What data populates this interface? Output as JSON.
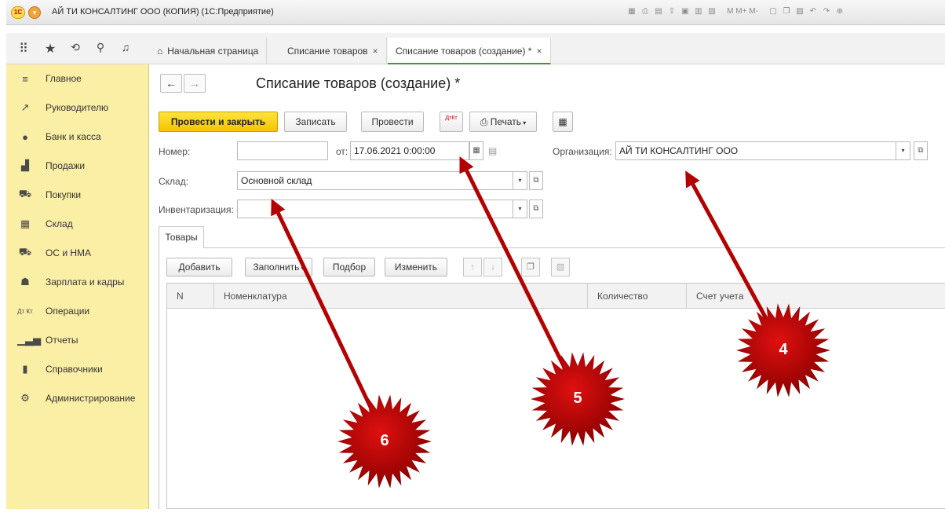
{
  "window": {
    "title": "АЙ ТИ КОНСАЛТИНГ ООО (КОПИЯ)  (1С:Предприятие)",
    "logo_text": "1С",
    "toolbar_text": "M  M+  M-"
  },
  "tabs": [
    {
      "label": "Начальная страница"
    },
    {
      "label": "Списание товаров",
      "close": "×"
    },
    {
      "label": "Списание товаров (создание) *",
      "close": "×"
    }
  ],
  "sidebar": {
    "items": [
      {
        "label": "Главное",
        "icon": "menu-lines-icon"
      },
      {
        "label": "Руководителю",
        "icon": "trend-icon"
      },
      {
        "label": "Банк и касса",
        "icon": "ruble-coin-icon"
      },
      {
        "label": "Продажи",
        "icon": "shopping-bag-icon"
      },
      {
        "label": "Покупки",
        "icon": "cart-icon"
      },
      {
        "label": "Склад",
        "icon": "warehouse-grid-icon"
      },
      {
        "label": "ОС и НМА",
        "icon": "truck-icon"
      },
      {
        "label": "Зарплата и кадры",
        "icon": "person-icon"
      },
      {
        "label": "Операции",
        "icon": "dt-kt-icon"
      },
      {
        "label": "Отчеты",
        "icon": "bar-chart-icon"
      },
      {
        "label": "Справочники",
        "icon": "books-icon"
      },
      {
        "label": "Администрирование",
        "icon": "gear-icon"
      }
    ]
  },
  "document": {
    "title": "Списание товаров (создание) *",
    "buttons": {
      "post_close": "Провести и закрыть",
      "save": "Записать",
      "post": "Провести",
      "print": "Печать",
      "dtkt": "ДтКт"
    },
    "fields": {
      "number_label": "Номер:",
      "number_value": "",
      "date_label": "от:",
      "date_value": "17.06.2021  0:00:00",
      "org_label": "Организация:",
      "org_value": "АЙ ТИ КОНСАЛТИНГ ООО",
      "warehouse_label": "Склад:",
      "warehouse_value": "Основной склад",
      "inventory_label": "Инвентаризация:",
      "inventory_value": ""
    },
    "page_tab": "Товары",
    "table_toolbar": {
      "add": "Добавить",
      "fill": "Заполнить",
      "pick": "Подбор",
      "change": "Изменить"
    },
    "table_columns": [
      "N",
      "Номенклатура",
      "Количество",
      "Счет учета"
    ]
  },
  "annotations": {
    "markers": [
      "4",
      "5",
      "6"
    ],
    "color": "#b30000"
  }
}
